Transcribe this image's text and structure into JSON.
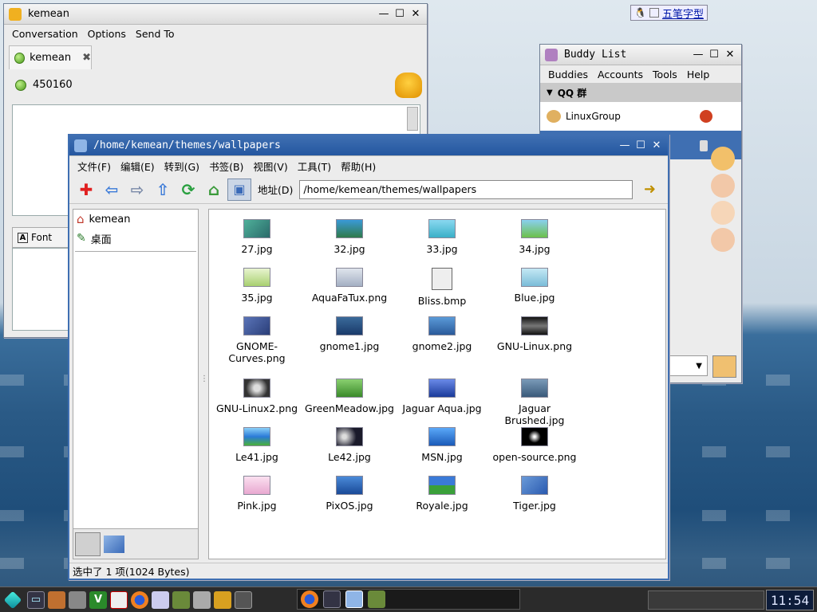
{
  "conversation_window": {
    "title": "kemean",
    "menu": [
      "Conversation",
      "Options",
      "Send To"
    ],
    "tab_label": "kemean",
    "buddy_number": "450160",
    "font_button": "Font"
  },
  "buddy_list": {
    "title": "Buddy List",
    "menu": [
      "Buddies",
      "Accounts",
      "Tools",
      "Help"
    ],
    "group_name": "QQ 群",
    "group_item": "LinuxGroup"
  },
  "file_manager": {
    "title": "/home/kemean/themes/wallpapers",
    "menu": [
      "文件(F)",
      "编辑(E)",
      "转到(G)",
      "书签(B)",
      "视图(V)",
      "工具(T)",
      "帮助(H)"
    ],
    "address_label": "地址(D)",
    "address_value": "/home/kemean/themes/wallpapers",
    "sidebar": [
      "kemean",
      "桌面"
    ],
    "files": [
      {
        "name": "27.jpg",
        "color": "#3a8a7a"
      },
      {
        "name": "32.jpg",
        "color": "#2f7a4a"
      },
      {
        "name": "33.jpg",
        "color": "#5ab8d8"
      },
      {
        "name": "34.jpg",
        "color": "#6cc04a"
      },
      {
        "name": "35.jpg",
        "color": "#a8d070"
      },
      {
        "name": "AquaFaTux.png",
        "color": "#b8c4d4"
      },
      {
        "name": "Bliss.bmp",
        "color": "#e8e8e8"
      },
      {
        "name": "Blue.jpg",
        "color": "#9ad0e8"
      },
      {
        "name": "GNOME-\nCurves.png",
        "color": "#3a4e8a"
      },
      {
        "name": "gnome1.jpg",
        "color": "#2a5a8a"
      },
      {
        "name": "gnome2.jpg",
        "color": "#3a7ab8"
      },
      {
        "name": "GNU-Linux.png",
        "color": "#222222"
      },
      {
        "name": "GNU-Linux2.png",
        "color": "#333333"
      },
      {
        "name": "GreenMeadow.jpg",
        "color": "#5aa83a"
      },
      {
        "name": "Jaguar Aqua.jpg",
        "color": "#2a4ea8"
      },
      {
        "name": "Jaguar Brushed.jpg",
        "color": "#4a6a8a"
      },
      {
        "name": "Le41.jpg",
        "color": "#2a7ad8"
      },
      {
        "name": "Le42.jpg",
        "color": "#1a1a2a"
      },
      {
        "name": "MSN.jpg",
        "color": "#3a8ae8"
      },
      {
        "name": "open-source.png",
        "color": "#0a0a0a"
      },
      {
        "name": "Pink.jpg",
        "color": "#f0c8e0"
      },
      {
        "name": "PixOS.jpg",
        "color": "#2a6ab8"
      },
      {
        "name": "Royale.jpg",
        "color": "#3a8a3a"
      },
      {
        "name": "Tiger.jpg",
        "color": "#3a6ab8"
      }
    ],
    "status": "选中了 1 项(1024 Bytes)"
  },
  "ime": {
    "label": "五笔字型"
  },
  "clock": "11:54"
}
